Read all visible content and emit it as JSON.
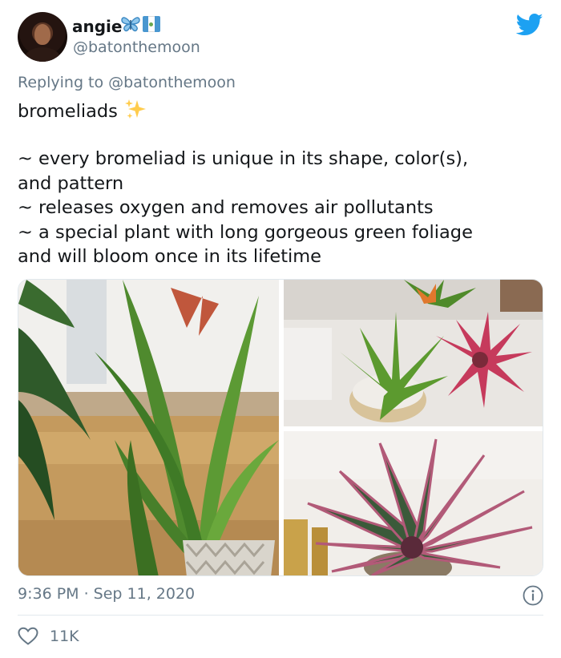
{
  "user": {
    "name": "angie",
    "handle": "@batonthemoon",
    "name_emoji": [
      "butterfly-emoji",
      "guatemala-flag-emoji"
    ]
  },
  "reply": {
    "prefix": "Replying to",
    "mention": "@batonthemoon"
  },
  "tweet": {
    "lines": [
      "bromeliads",
      "",
      "~ every bromeliad is unique in its shape, color(s),",
      "and pattern",
      "~ releases oxygen and removes air pollutants",
      "~ a special plant with long gorgeous green foliage",
      "and will bloom once in its lifetime"
    ],
    "emoji_after_first_line": "sparkles-emoji"
  },
  "media": {
    "photos": [
      {
        "name": "photo-bromeliad-window",
        "description_icon": "image"
      },
      {
        "name": "photo-bromeliads-pots",
        "description_icon": "image"
      },
      {
        "name": "photo-bromeliad-purple",
        "description_icon": "image"
      }
    ]
  },
  "meta": {
    "timestamp": "9:36 PM · Sep 11, 2020"
  },
  "actions": {
    "like_count": "11K"
  },
  "colors": {
    "twitter_blue": "#1da1f2",
    "secondary_text": "#657786",
    "primary_text": "#14171a",
    "divider": "#e1e8ed"
  }
}
